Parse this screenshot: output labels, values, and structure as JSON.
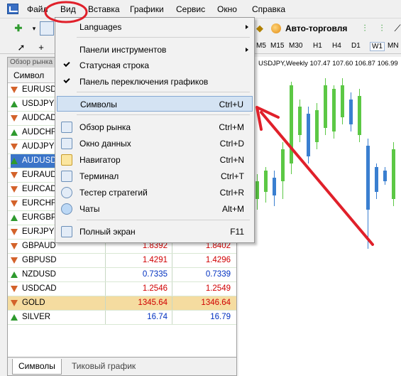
{
  "menu": {
    "items": [
      "Файл",
      "Вид",
      "Вставка",
      "Графики",
      "Сервис",
      "Окно",
      "Справка"
    ]
  },
  "toolbar": {
    "auto_trading": "Авто-торговля",
    "timeframes": [
      "M5",
      "M15",
      "M30",
      "H1",
      "H4",
      "D1",
      "W1",
      "MN"
    ],
    "active_timeframe": "W1"
  },
  "panel": {
    "caption": "Обзор рынка",
    "column_header": "Символ",
    "rows": [
      {
        "symbol": "EURUSD",
        "bid": "",
        "ask": "",
        "dir": "down"
      },
      {
        "symbol": "USDJPY",
        "bid": "",
        "ask": "",
        "dir": "up"
      },
      {
        "symbol": "AUDCAD",
        "bid": "",
        "ask": "",
        "dir": "down"
      },
      {
        "symbol": "AUDCHF",
        "bid": "",
        "ask": "",
        "dir": "up"
      },
      {
        "symbol": "AUDJPY",
        "bid": "",
        "ask": "",
        "dir": "down"
      },
      {
        "symbol": "AUDUSD",
        "bid": "",
        "ask": "",
        "dir": "up"
      },
      {
        "symbol": "EURAUD",
        "bid": "",
        "ask": "",
        "dir": "down"
      },
      {
        "symbol": "EURCAD",
        "bid": "",
        "ask": "",
        "dir": "down"
      },
      {
        "symbol": "EURCHF",
        "bid": "",
        "ask": "",
        "dir": "down"
      },
      {
        "symbol": "EURGBP",
        "bid": "",
        "ask": "",
        "dir": "up"
      },
      {
        "symbol": "EURJPY",
        "bid": "",
        "ask": "",
        "dir": "down"
      },
      {
        "symbol": "GBPAUD",
        "bid": "1.8392",
        "ask": "1.8402",
        "dir": "down"
      },
      {
        "symbol": "GBPUSD",
        "bid": "1.4291",
        "ask": "1.4296",
        "dir": "down"
      },
      {
        "symbol": "NZDUSD",
        "bid": "0.7335",
        "ask": "0.7339",
        "dir": "up"
      },
      {
        "symbol": "USDCAD",
        "bid": "1.2546",
        "ask": "1.2549",
        "dir": "down"
      },
      {
        "symbol": "GOLD",
        "bid": "1345.64",
        "ask": "1346.64",
        "dir": "down"
      },
      {
        "symbol": "SILVER",
        "bid": "16.74",
        "ask": "16.79",
        "dir": "up"
      }
    ],
    "tabs": [
      "Символы",
      "Тиковый график"
    ]
  },
  "chart": {
    "title": "USDJPY,Weekly  107.47 107.60 106.87 106.99"
  },
  "dropdown": {
    "items": [
      {
        "label": "Languages",
        "shortcut": "",
        "submenu": true
      },
      {
        "label": "Панели инструментов",
        "shortcut": "",
        "submenu": true
      },
      {
        "label": "Статусная строка",
        "shortcut": "",
        "checked": true
      },
      {
        "label": "Панель переключения графиков",
        "shortcut": "",
        "checked": true
      },
      {
        "label": "Символы",
        "shortcut": "Ctrl+U",
        "highlighted": true
      },
      {
        "label": "Обзор рынка",
        "shortcut": "Ctrl+M"
      },
      {
        "label": "Окно данных",
        "shortcut": "Ctrl+D"
      },
      {
        "label": "Навигатор",
        "shortcut": "Ctrl+N"
      },
      {
        "label": "Терминал",
        "shortcut": "Ctrl+T"
      },
      {
        "label": "Тестер стратегий",
        "shortcut": "Ctrl+R"
      },
      {
        "label": "Чаты",
        "shortcut": "Alt+M"
      },
      {
        "label": "Полный экран",
        "shortcut": "F11"
      }
    ]
  },
  "colors": {
    "annotation": "#e0202a",
    "bull_candle": "#5cc845",
    "bear_candle": "#3a7fd0",
    "highlight": "#d4e3f3"
  }
}
